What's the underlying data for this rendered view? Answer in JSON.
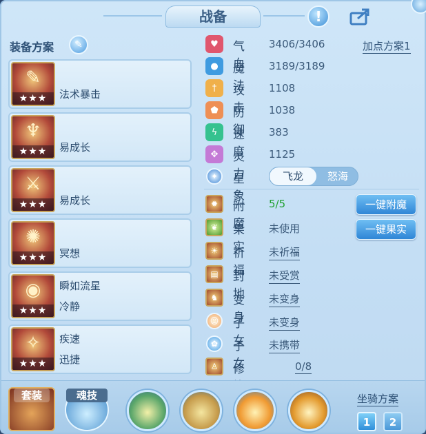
{
  "header": {
    "title": "战备"
  },
  "left": {
    "title": "装备方案",
    "plans": [
      {
        "lines": [
          "",
          "法术暴击"
        ],
        "stars": "★★★",
        "glyph": "✎"
      },
      {
        "lines": [
          "",
          "易成长"
        ],
        "stars": "★★★",
        "glyph": "♆"
      },
      {
        "lines": [
          "",
          "易成长"
        ],
        "stars": "★★★",
        "glyph": "⚔"
      },
      {
        "lines": [
          "",
          "冥想"
        ],
        "stars": "★★★",
        "glyph": "✺"
      },
      {
        "lines": [
          "瞬如流星",
          "冷静"
        ],
        "stars": "★★★",
        "glyph": "◉"
      },
      {
        "lines": [
          "疾速",
          "迅捷"
        ],
        "stars": "★★★",
        "glyph": "✧"
      }
    ]
  },
  "stats": {
    "add_points_plan": "加点方案1",
    "items": [
      {
        "label": "气血",
        "value": "3406/3406",
        "icon": "heart-icon",
        "color": "#e0566d",
        "glyph": "♥"
      },
      {
        "label": "魔法",
        "value": "3189/3189",
        "icon": "mana-icon",
        "color": "#3f9be0",
        "glyph": "●"
      },
      {
        "label": "攻击",
        "value": "1108",
        "icon": "attack-icon",
        "color": "#f0b04a",
        "glyph": "†"
      },
      {
        "label": "防御",
        "value": "1038",
        "icon": "defense-icon",
        "color": "#ee8f55",
        "glyph": "⬟"
      },
      {
        "label": "速度",
        "value": "383",
        "icon": "speed-icon",
        "color": "#35c28f",
        "glyph": "ϟ"
      },
      {
        "label": "灵力",
        "value": "1125",
        "icon": "spirit-icon",
        "color": "#c47ad6",
        "glyph": "✥"
      }
    ],
    "constellation": {
      "label": "星象",
      "options": [
        "飞龙",
        "怒海"
      ],
      "selected": "飞龙"
    }
  },
  "features": {
    "items": [
      {
        "label": "附魔",
        "value": "5/5",
        "value_color": "#1fa02e",
        "icon": "enchant-icon",
        "kind": "square",
        "glyph": "✹",
        "underline": false
      },
      {
        "label": "果实",
        "value": "未使用",
        "value_color": "#3b5a7a",
        "icon": "fruit-icon",
        "kind": "square",
        "glyph": "❦",
        "underline": false
      },
      {
        "label": "祈福",
        "value": "未祈福",
        "value_color": "#3b5a7a",
        "icon": "blessing-icon",
        "kind": "square",
        "glyph": "☀",
        "underline": true
      },
      {
        "label": "封地",
        "value": "未受赏",
        "value_color": "#3b5a7a",
        "icon": "fief-icon",
        "kind": "square",
        "glyph": "▤",
        "underline": true
      },
      {
        "label": "变身",
        "value": "未变身",
        "value_color": "#3b5a7a",
        "icon": "transform-icon",
        "kind": "square",
        "glyph": "♞",
        "underline": true
      },
      {
        "label": "子女",
        "value": "未变身",
        "value_color": "#3b5a7a",
        "icon": "child-icon",
        "kind": "round",
        "glyph": "☺",
        "underline": true
      },
      {
        "label": "子女",
        "value": "未携带",
        "value_color": "#3b5a7a",
        "icon": "pet-paw-icon",
        "kind": "round",
        "glyph": "✿",
        "underline": true
      },
      {
        "label": "修炼觉醒",
        "value": "0/8",
        "value_color": "#3b5a7a",
        "icon": "cultivation-icon",
        "kind": "square",
        "glyph": "♙",
        "underline": true
      }
    ],
    "one_click_enchant": "一键附魔",
    "one_click_fruit": "一键果实"
  },
  "bottom": {
    "suit_label": "套装",
    "soul_skill_label": "魂技",
    "mount_plan_title": "坐骑方案",
    "mount_plans": [
      "1",
      "2"
    ],
    "mount_selected": "1"
  },
  "colors": {
    "panel_bg": "#c4def4",
    "accent_blue": "#2f86d6",
    "text_dark": "#2a4a6c",
    "enchant_green": "#1fa02e"
  }
}
